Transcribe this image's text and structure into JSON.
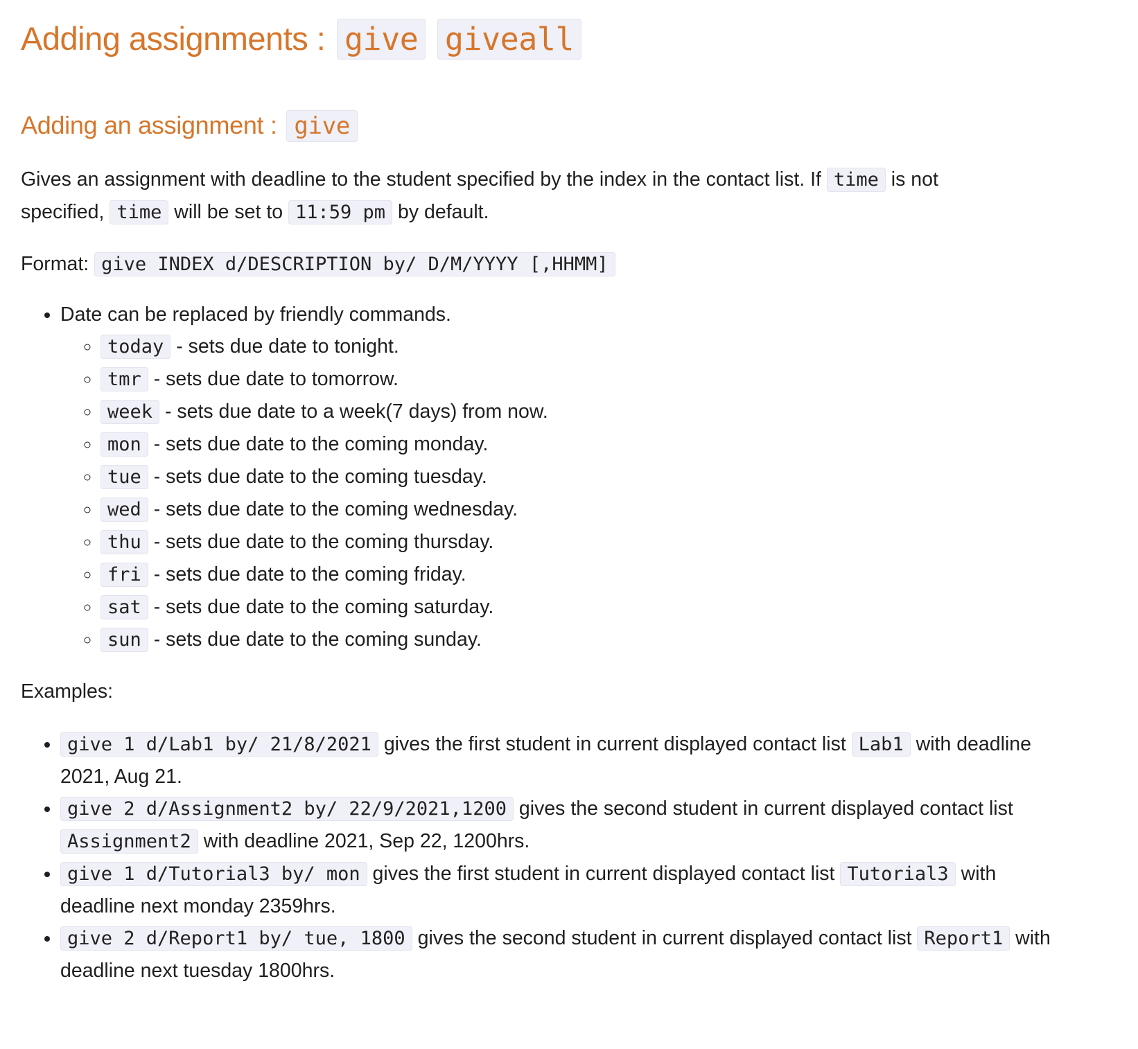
{
  "heading1": {
    "text": "Adding assignments : ",
    "code1": "give",
    "code2": "giveall"
  },
  "heading2": {
    "text": "Adding an assignment : ",
    "code": "give"
  },
  "intro": {
    "part1": "Gives an assignment with deadline to the student specified by the index in the contact list. If ",
    "code1": "time",
    "part2": " is not specified, ",
    "code2": "time",
    "part3": " will be set to ",
    "code3": "11:59 pm",
    "part4": " by default."
  },
  "format": {
    "label": "Format: ",
    "code": "give INDEX d/DESCRIPTION by/ D/M/YYYY [,HHMM]"
  },
  "friendly": {
    "text": "Date can be replaced by friendly commands.",
    "items": [
      {
        "code": "today",
        "desc": " - sets due date to tonight."
      },
      {
        "code": "tmr",
        "desc": " - sets due date to tomorrow."
      },
      {
        "code": "week",
        "desc": " - sets due date to a week(7 days) from now."
      },
      {
        "code": "mon",
        "desc": " - sets due date to the coming monday."
      },
      {
        "code": "tue",
        "desc": " - sets due date to the coming tuesday."
      },
      {
        "code": "wed",
        "desc": " - sets due date to the coming wednesday."
      },
      {
        "code": "thu",
        "desc": " - sets due date to the coming thursday."
      },
      {
        "code": "fri",
        "desc": " - sets due date to the coming friday."
      },
      {
        "code": "sat",
        "desc": " - sets due date to the coming saturday."
      },
      {
        "code": "sun",
        "desc": " - sets due date to the coming sunday."
      }
    ]
  },
  "examples": {
    "label": "Examples:",
    "items": [
      {
        "code": "give 1 d/Lab1 by/ 21/8/2021",
        "text1": " gives the first student in current displayed contact list ",
        "code2": "Lab1",
        "text2": " with deadline 2021, Aug 21."
      },
      {
        "code": "give 2 d/Assignment2 by/ 22/9/2021,1200",
        "text1": " gives the second student in current displayed contact list ",
        "code2": "Assignment2",
        "text2": " with deadline 2021, Sep 22, 1200hrs."
      },
      {
        "code": "give 1 d/Tutorial3 by/ mon",
        "text1": " gives the first student in current displayed contact list ",
        "code2": "Tutorial3",
        "text2": " with deadline next monday 2359hrs."
      },
      {
        "code": "give 2 d/Report1 by/ tue, 1800",
        "text1": " gives the second student in current displayed contact list ",
        "code2": "Report1",
        "text2": " with deadline next tuesday 1800hrs."
      }
    ]
  }
}
